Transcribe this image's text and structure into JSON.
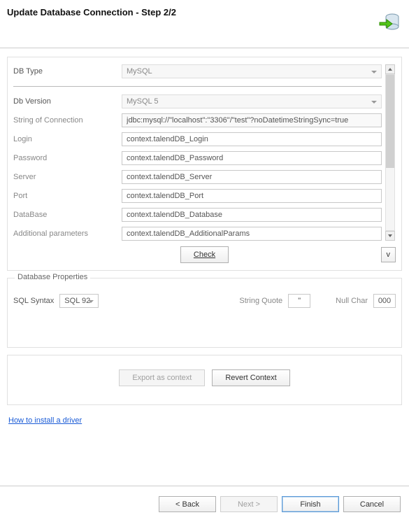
{
  "header": {
    "title": "Update Database Connection - Step 2/2"
  },
  "form": {
    "db_type_label": "DB Type",
    "db_type_value": "MySQL",
    "db_version_label": "Db Version",
    "db_version_value": "MySQL 5",
    "conn_str_label": "String of Connection",
    "conn_str_value": "jdbc:mysql://\"localhost\":\"3306\"/\"test\"?noDatetimeStringSync=true",
    "login_label": "Login",
    "login_value": "context.talendDB_Login",
    "password_label": "Password",
    "password_value": "context.talendDB_Password",
    "server_label": "Server",
    "server_value": "context.talendDB_Server",
    "port_label": "Port",
    "port_value": "context.talendDB_Port",
    "database_label": "DataBase",
    "database_value": "context.talendDB_Database",
    "addparams_label": "Additional parameters",
    "addparams_value": "context.talendDB_AdditionalParams"
  },
  "buttons": {
    "check": "Check",
    "export_ctx": "Export as context",
    "revert_ctx": "Revert Context",
    "back": "< Back",
    "next": "Next >",
    "finish": "Finish",
    "cancel": "Cancel",
    "expand": "v"
  },
  "dbprops": {
    "section_title": "Database Properties",
    "sql_syntax_label": "SQL Syntax",
    "sql_syntax_value": "SQL 92",
    "string_quote_label": "String Quote",
    "string_quote_value": "\"",
    "null_char_label": "Null Char",
    "null_char_value": "000"
  },
  "link": {
    "install_driver": "How to install a driver"
  }
}
